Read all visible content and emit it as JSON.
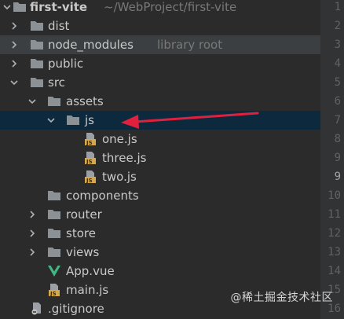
{
  "project": {
    "name": "first-vite",
    "path": "~/WebProject/first-vite"
  },
  "tree": [
    {
      "label": "first-vite",
      "type": "folder",
      "expanded": true,
      "icon": "folder-icon"
    },
    {
      "label": "dist",
      "type": "folder",
      "expanded": false,
      "icon": "folder-icon"
    },
    {
      "label": "node_modules",
      "hint": "library root",
      "type": "folder",
      "expanded": false,
      "icon": "folder-icon"
    },
    {
      "label": "public",
      "type": "folder",
      "expanded": false,
      "icon": "folder-icon"
    },
    {
      "label": "src",
      "type": "folder",
      "expanded": true,
      "icon": "folder-icon"
    },
    {
      "label": "assets",
      "type": "folder",
      "expanded": true,
      "icon": "folder-icon"
    },
    {
      "label": "js",
      "type": "folder",
      "expanded": true,
      "selected": true,
      "icon": "folder-icon"
    },
    {
      "label": "one.js",
      "type": "file",
      "icon": "js-file-icon"
    },
    {
      "label": "three.js",
      "type": "file",
      "icon": "js-file-icon"
    },
    {
      "label": "two.js",
      "type": "file",
      "icon": "js-file-icon"
    },
    {
      "label": "components",
      "type": "folder",
      "icon": "folder-icon"
    },
    {
      "label": "router",
      "type": "folder",
      "expanded": false,
      "icon": "folder-icon"
    },
    {
      "label": "store",
      "type": "folder",
      "expanded": false,
      "icon": "folder-icon"
    },
    {
      "label": "views",
      "type": "folder",
      "expanded": false,
      "icon": "folder-icon"
    },
    {
      "label": "App.vue",
      "type": "file",
      "icon": "vue-file-icon"
    },
    {
      "label": "main.js",
      "type": "file",
      "icon": "js-file-icon"
    },
    {
      "label": ".gitignore",
      "type": "file",
      "icon": "gitignore-file-icon"
    }
  ],
  "gutter": {
    "lines": [
      "1",
      "2",
      "3",
      "4",
      "5",
      "6",
      "7",
      "8",
      "9",
      "10",
      "11",
      "12",
      "13",
      "14",
      "15",
      "16",
      "17"
    ],
    "current": "9"
  },
  "watermark": {
    "text": "@稀土掘金技术社区"
  },
  "colors": {
    "background": "#2b2b2b",
    "selection": "#0d293e",
    "highlight_row": "#3c3f41",
    "arrow": "#e0203c",
    "folder": "#8c9196",
    "vue_green": "#41b883",
    "js_yellow": "#d6a847"
  }
}
